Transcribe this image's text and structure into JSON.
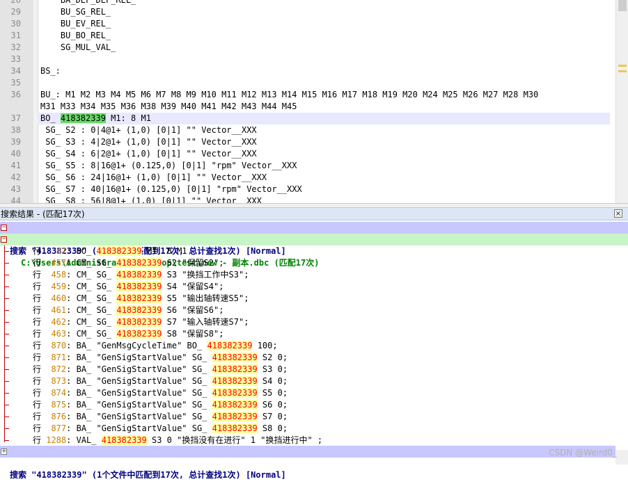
{
  "editor": {
    "lines": [
      {
        "num": "28",
        "text": "    BA_DEF_DEF_REL_"
      },
      {
        "num": "29",
        "text": "    BU_SG_REL_"
      },
      {
        "num": "30",
        "text": "    BU_EV_REL_"
      },
      {
        "num": "31",
        "text": "    BU_BO_REL_"
      },
      {
        "num": "32",
        "text": "    SG_MUL_VAL_"
      },
      {
        "num": "33",
        "text": ""
      },
      {
        "num": "34",
        "text": "BS_:"
      },
      {
        "num": "35",
        "text": ""
      },
      {
        "num": "36",
        "text": "BU_: M1 M2 M3 M4 M5 M6 M7 M8 M9 M10 M11 M12 M13 M14 M15 M16 M17 M18 M19 M20 M24 M25 M26 M27 M28 M30"
      },
      {
        "num": "",
        "text": "M31 M33 M34 M35 M36 M38 M39 M40 M41 M42 M43 M44 M45"
      },
      {
        "num": "37",
        "pre": "BO_ ",
        "hit": "418382339",
        "post": " M1: 8 M1",
        "current": true
      },
      {
        "num": "38",
        "text": " SG_ S2 : 0|4@1+ (1,0) [0|1] \"\" Vector__XXX"
      },
      {
        "num": "39",
        "text": " SG_ S3 : 4|2@1+ (1,0) [0|1] \"\" Vector__XXX"
      },
      {
        "num": "40",
        "text": " SG_ S4 : 6|2@1+ (1,0) [0|1] \"\" Vector__XXX"
      },
      {
        "num": "41",
        "text": " SG_ S5 : 8|16@1+ (0.125,0) [0|1] \"rpm\" Vector__XXX"
      },
      {
        "num": "42",
        "text": " SG_ S6 : 24|16@1+ (1,0) [0|1] \"\" Vector__XXX"
      },
      {
        "num": "43",
        "text": " SG_ S7 : 40|16@1+ (0.125,0) [0|1] \"rpm\" Vector__XXX"
      },
      {
        "num": "44",
        "text": " SG_ S8 : 56|8@1+ (1,0) [0|1] \"\" Vector__XXX"
      }
    ]
  },
  "results": {
    "title": "搜索结果 - (匹配17次)",
    "close_label": "×",
    "search_header": {
      "label": "搜索 \"418382339\"",
      "summary": " (1个文件中匹配到17次, 总计查找1次) ",
      "mode": "[Normal]"
    },
    "file_header": {
      "path": "C:\\Users\\Administrator\\Desktop\\test\\new - 副本.dbc",
      "count": " (匹配17次)"
    },
    "line_prefix": "行",
    "hits": [
      {
        "line": "37",
        "pre": "BO_ ",
        "hit": "418382339",
        "post": " M1: 8 M1"
      },
      {
        "line": "457",
        "pre": "CM_ SG_ ",
        "hit": "418382339",
        "post": " S2 \"保留S2\";"
      },
      {
        "line": "458",
        "pre": "CM_ SG_ ",
        "hit": "418382339",
        "post": " S3 \"换挡工作中S3\";"
      },
      {
        "line": "459",
        "pre": "CM_ SG_ ",
        "hit": "418382339",
        "post": " S4 \"保留S4\";"
      },
      {
        "line": "460",
        "pre": "CM_ SG_ ",
        "hit": "418382339",
        "post": " S5 \"输出轴转速S5\";"
      },
      {
        "line": "461",
        "pre": "CM_ SG_ ",
        "hit": "418382339",
        "post": " S6 \"保留S6\";"
      },
      {
        "line": "462",
        "pre": "CM_ SG_ ",
        "hit": "418382339",
        "post": " S7 \"输入轴转速S7\";"
      },
      {
        "line": "463",
        "pre": "CM_ SG_ ",
        "hit": "418382339",
        "post": " S8 \"保留S8\";"
      },
      {
        "line": "870",
        "pre": "BA_ \"GenMsgCycleTime\" BO_ ",
        "hit": "418382339",
        "post": " 100;"
      },
      {
        "line": "871",
        "pre": "BA_ \"GenSigStartValue\" SG_ ",
        "hit": "418382339",
        "post": " S2 0;"
      },
      {
        "line": "872",
        "pre": "BA_ \"GenSigStartValue\" SG_ ",
        "hit": "418382339",
        "post": " S3 0;"
      },
      {
        "line": "873",
        "pre": "BA_ \"GenSigStartValue\" SG_ ",
        "hit": "418382339",
        "post": " S4 0;"
      },
      {
        "line": "874",
        "pre": "BA_ \"GenSigStartValue\" SG_ ",
        "hit": "418382339",
        "post": " S5 0;"
      },
      {
        "line": "875",
        "pre": "BA_ \"GenSigStartValue\" SG_ ",
        "hit": "418382339",
        "post": " S6 0;"
      },
      {
        "line": "876",
        "pre": "BA_ \"GenSigStartValue\" SG_ ",
        "hit": "418382339",
        "post": " S7 0;"
      },
      {
        "line": "877",
        "pre": "BA_ \"GenSigStartValue\" SG_ ",
        "hit": "418382339",
        "post": " S8 0;"
      },
      {
        "line": "1288",
        "pre": "VAL_ ",
        "hit": "418382339",
        "post": " S3 0 \"换挡没有在进行\" 1 \"换挡进行中\" ;"
      }
    ],
    "footer_search": {
      "label": "搜索 \"418382339\"",
      "summary": " (1个文件中匹配到17次, 总计查找1次) ",
      "mode": "[Normal]"
    },
    "watermark": "CSDN @Weird0_"
  },
  "colors": {
    "match_current_bg": "#6ad96a",
    "hit_text": "#ff0000",
    "hit_bg": "#ffff9c",
    "search_row_bg": "#c8c8ff",
    "file_row_bg": "#c8f5c8"
  }
}
